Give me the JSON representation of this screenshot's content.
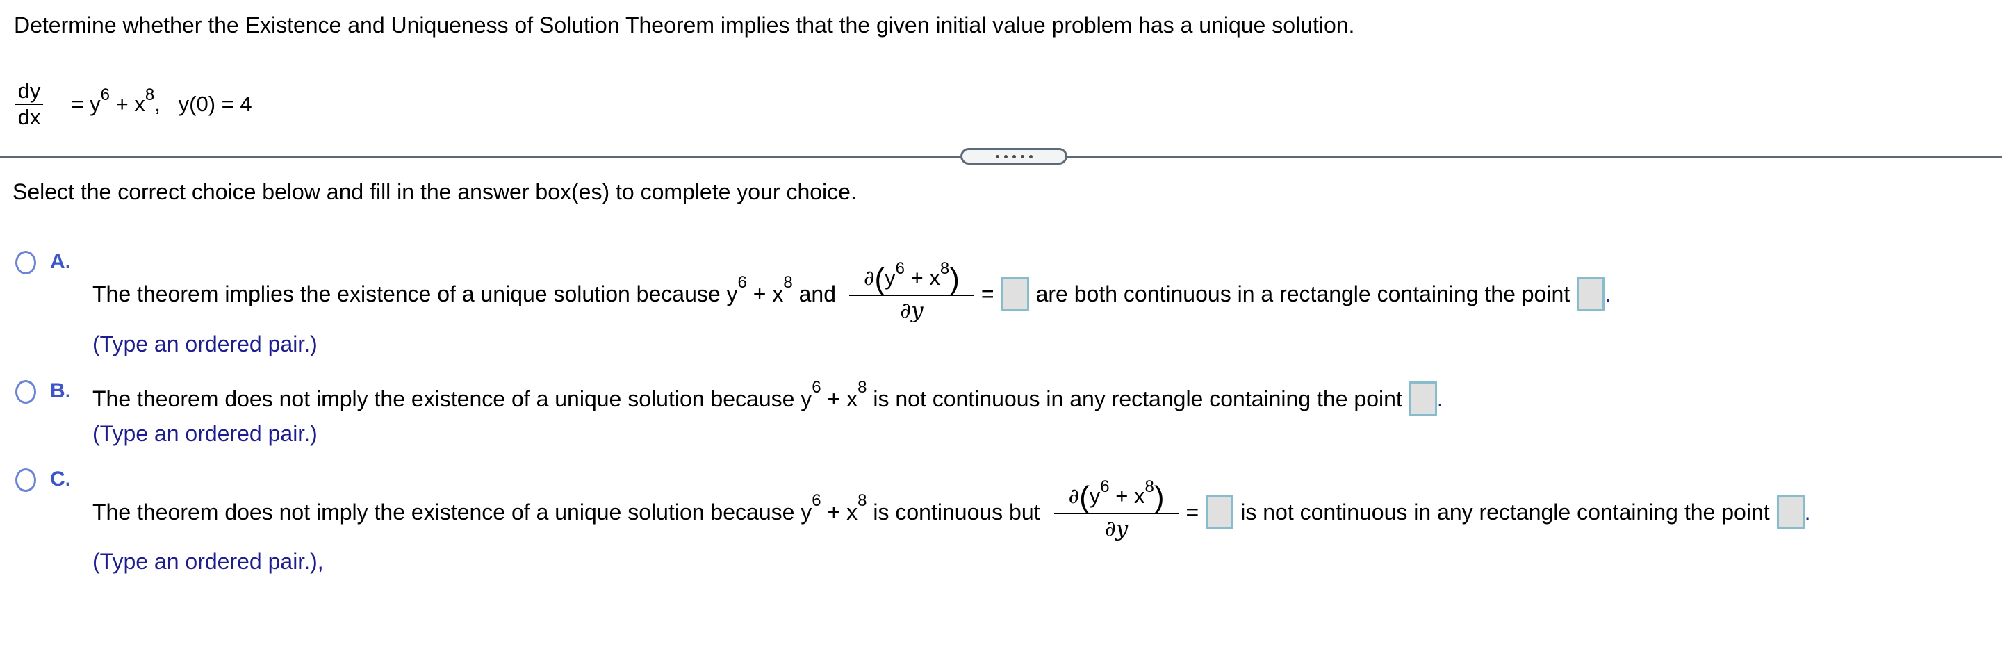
{
  "question": {
    "prompt": "Determine whether the Existence and Uniqueness of Solution Theorem implies that the given initial value problem has a unique solution.",
    "equation": {
      "lhs_numerator": "dy",
      "lhs_denominator": "dx",
      "rhs_prefix": "= y",
      "exp_y": "6",
      "rhs_mid": " + x",
      "exp_x": "8",
      "initial_condition": ",   y(0) = 4"
    }
  },
  "divider": {
    "expander_icon": "more-dots-icon",
    "expander_dots": 5
  },
  "instruction": "Select the correct choice below and fill in the answer box(es) to complete your choice.",
  "colors": {
    "option_letter": "#3c56c8",
    "hint_text": "#1d1d8f",
    "answer_box_fill": "#e0e0e0",
    "answer_box_border": "#86bccb",
    "divider": "#5d6b79"
  },
  "options": {
    "a": {
      "letter": "A.",
      "text_1": "The theorem implies the existence of a unique solution because y",
      "exp_y": "6",
      "plus_x": " + x",
      "exp_x": "8",
      "text_2": " and ",
      "partial_num_d": "∂",
      "partial_num_open": "(",
      "partial_num_y": "y",
      "partial_num_plus_x": " + x",
      "partial_num_close": ")",
      "partial_den": "∂y",
      "equals": "=",
      "text_3": "are both continuous in a rectangle containing the point",
      "period": ".",
      "hint": "(Type an ordered pair.)",
      "box1_value": "",
      "box2_value": ""
    },
    "b": {
      "letter": "B.",
      "text_1": "The theorem does not imply the existence of a unique solution because y",
      "exp_y": "6",
      "plus_x": " + x",
      "exp_x": "8",
      "text_2": " is not continuous in any rectangle containing the point",
      "period": ".",
      "hint": "(Type an ordered pair.)",
      "box1_value": ""
    },
    "c": {
      "letter": "C.",
      "text_1": "The theorem does not imply the existence of a unique solution because y",
      "exp_y": "6",
      "plus_x": " + x",
      "exp_x": "8",
      "text_2": " is continuous but",
      "partial_num_d": "∂",
      "partial_num_open": "(",
      "partial_num_y": "y",
      "partial_num_plus_x": " + x",
      "partial_num_close": ")",
      "partial_den": "∂y",
      "equals": "=",
      "text_3": "is not continuous in any rectangle containing the point",
      "period": ".",
      "hint": "(Type an ordered pair.),",
      "box1_value": "",
      "box2_value": ""
    }
  }
}
